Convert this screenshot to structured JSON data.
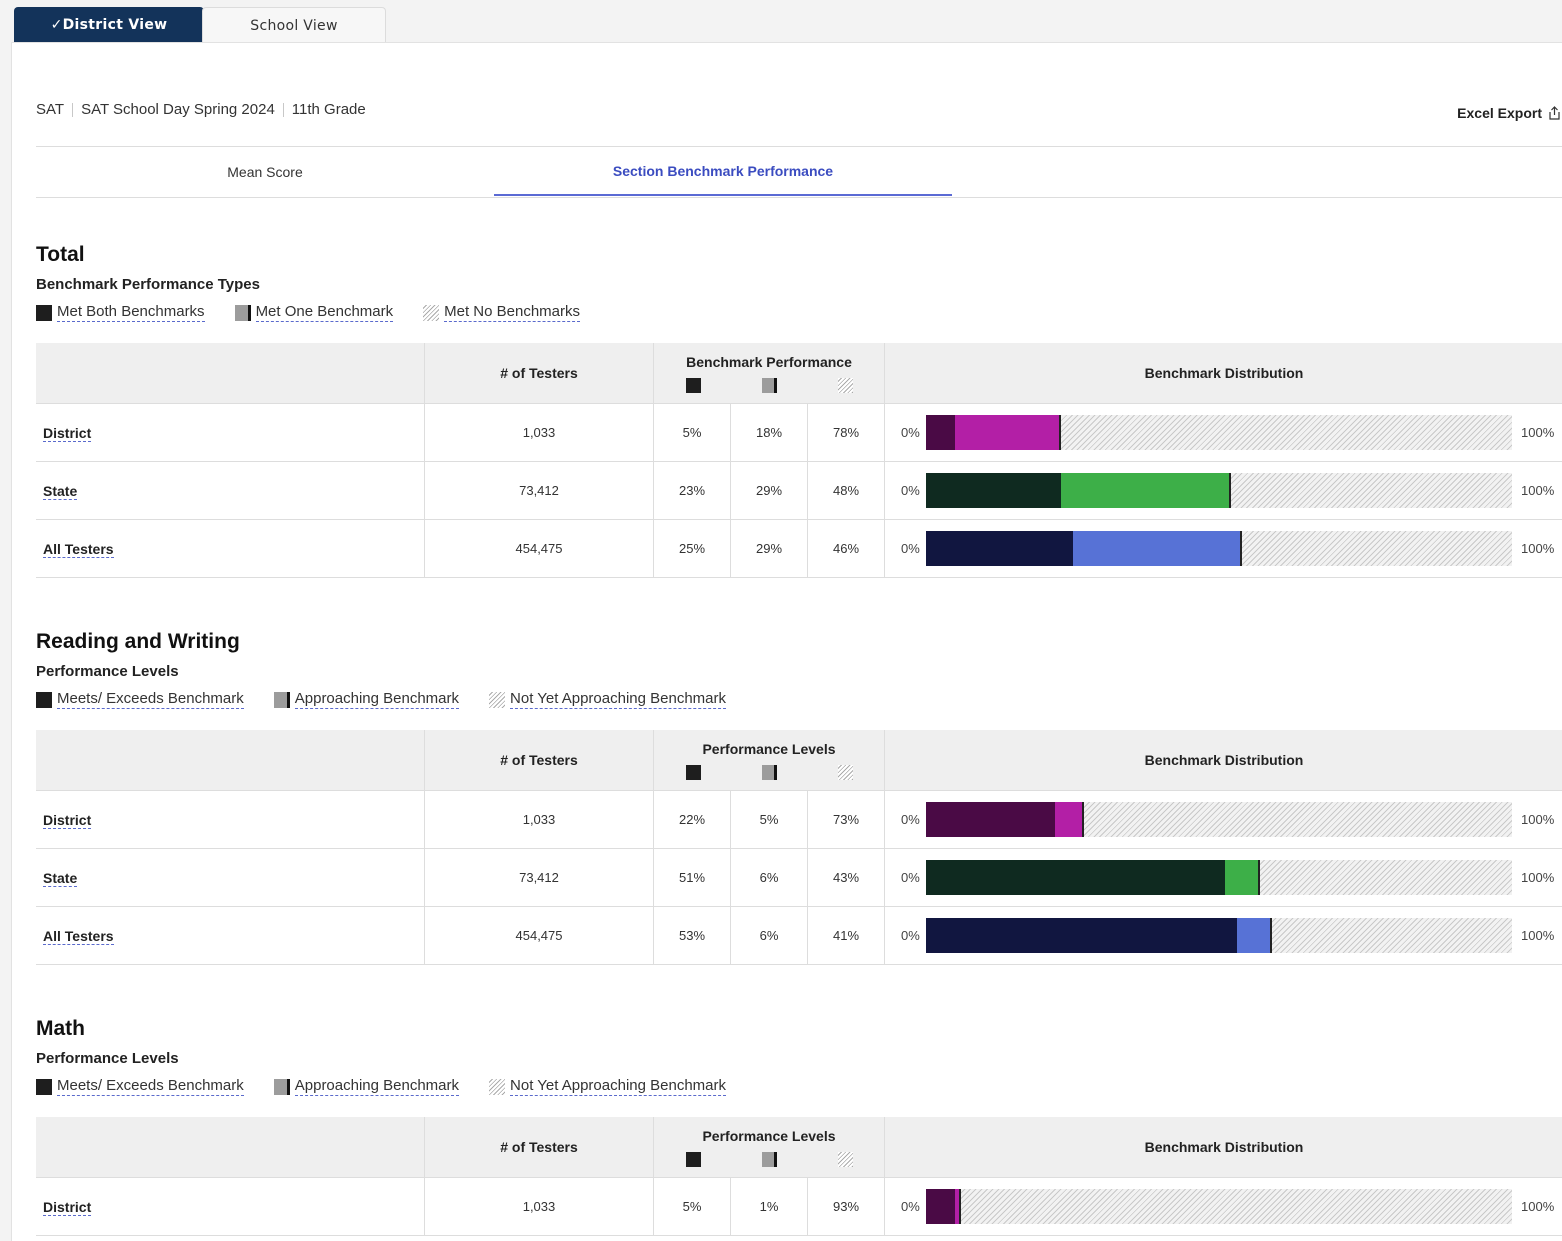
{
  "view_tabs": {
    "district": "District View",
    "school": "School View",
    "check": "✓"
  },
  "breadcrumb": {
    "test": "SAT",
    "administration": "SAT School Day Spring 2024",
    "grade": "11th Grade"
  },
  "excel_export": "Excel Export",
  "subtabs": {
    "mean": "Mean Score",
    "benchmark": "Section Benchmark Performance"
  },
  "colors": {
    "district_dark": "#4a0a45",
    "district_mid": "#b31fa6",
    "state_dark": "#0f2a20",
    "state_mid": "#3daf48",
    "all_dark": "#111640",
    "all_mid": "#5772d6"
  },
  "common": {
    "col_testers": "# of Testers",
    "col_distribution": "Benchmark Distribution",
    "zero": "0%",
    "hundred": "100%"
  },
  "sections": [
    {
      "title": "Total",
      "subtitle": "Benchmark Performance Types",
      "col_perf": "Benchmark Performance",
      "legend": [
        "Met Both Benchmarks",
        "Met One Benchmark",
        "Met No Benchmarks"
      ],
      "rows": [
        {
          "label": "District",
          "testers": "1,033",
          "p1": "5%",
          "p2": "18%",
          "p3": "78%",
          "v1": 5,
          "v2": 18,
          "scheme": "district"
        },
        {
          "label": "State",
          "testers": "73,412",
          "p1": "23%",
          "p2": "29%",
          "p3": "48%",
          "v1": 23,
          "v2": 29,
          "scheme": "state"
        },
        {
          "label": "All Testers",
          "testers": "454,475",
          "p1": "25%",
          "p2": "29%",
          "p3": "46%",
          "v1": 25,
          "v2": 29,
          "scheme": "all"
        }
      ]
    },
    {
      "title": "Reading and Writing",
      "subtitle": "Performance Levels",
      "col_perf": "Performance Levels",
      "legend": [
        "Meets/ Exceeds Benchmark",
        "Approaching Benchmark",
        "Not Yet Approaching Benchmark"
      ],
      "rows": [
        {
          "label": "District",
          "testers": "1,033",
          "p1": "22%",
          "p2": "5%",
          "p3": "73%",
          "v1": 22,
          "v2": 5,
          "scheme": "district"
        },
        {
          "label": "State",
          "testers": "73,412",
          "p1": "51%",
          "p2": "6%",
          "p3": "43%",
          "v1": 51,
          "v2": 6,
          "scheme": "state"
        },
        {
          "label": "All Testers",
          "testers": "454,475",
          "p1": "53%",
          "p2": "6%",
          "p3": "41%",
          "v1": 53,
          "v2": 6,
          "scheme": "all"
        }
      ]
    },
    {
      "title": "Math",
      "subtitle": "Performance Levels",
      "col_perf": "Performance Levels",
      "legend": [
        "Meets/ Exceeds Benchmark",
        "Approaching Benchmark",
        "Not Yet Approaching Benchmark"
      ],
      "rows": [
        {
          "label": "District",
          "testers": "1,033",
          "p1": "5%",
          "p2": "1%",
          "p3": "93%",
          "v1": 5,
          "v2": 1,
          "scheme": "district"
        }
      ]
    }
  ]
}
